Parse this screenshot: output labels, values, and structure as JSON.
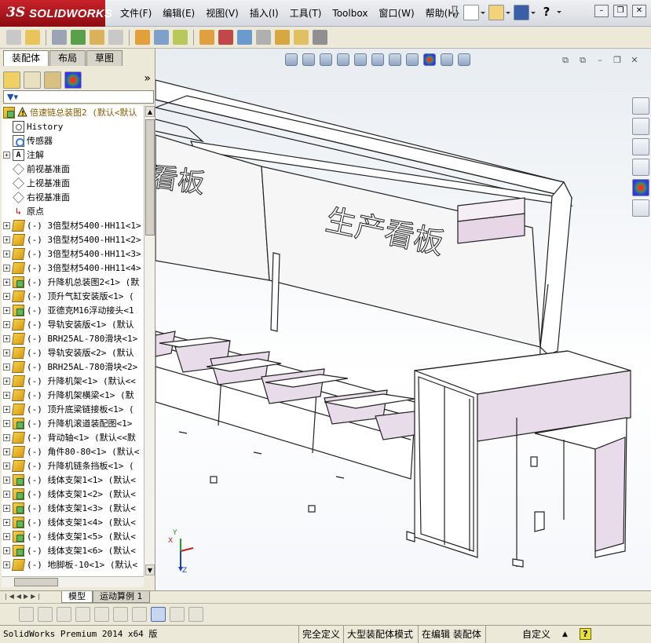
{
  "app": {
    "logo_prefix": "3S",
    "logo_name": "SOLIDWORKS"
  },
  "menu": [
    "文件(F)",
    "编辑(E)",
    "视图(V)",
    "插入(I)",
    "工具(T)",
    "Toolbox",
    "窗口(W)",
    "帮助(H)"
  ],
  "window_buttons": [
    "?",
    "–",
    "❐",
    "✕"
  ],
  "panel_tabs": [
    "装配体",
    "布局",
    "草图"
  ],
  "feature_tree": {
    "root": "倍速链总装图2  (默认<默认",
    "items": [
      {
        "label": "History",
        "icon": "history-icon",
        "expand": false
      },
      {
        "label": "传感器",
        "icon": "sensor-icon",
        "expand": false
      },
      {
        "label": "注解",
        "icon": "annotation-icon",
        "expand": true
      },
      {
        "label": "前视基准面",
        "icon": "plane-icon",
        "expand": false
      },
      {
        "label": "上视基准面",
        "icon": "plane-icon",
        "expand": false
      },
      {
        "label": "右视基准面",
        "icon": "plane-icon",
        "expand": false
      },
      {
        "label": "原点",
        "icon": "origin-icon",
        "expand": false
      },
      {
        "label": "(-) 3倍型材5400-HH11<1>",
        "icon": "part-icon",
        "expand": true
      },
      {
        "label": "(-) 3倍型材5400-HH11<2>",
        "icon": "part-icon",
        "expand": true
      },
      {
        "label": "(-) 3倍型材5400-HH11<3>",
        "icon": "part-icon",
        "expand": true
      },
      {
        "label": "(-) 3倍型材5400-HH11<4>",
        "icon": "part-icon",
        "expand": true
      },
      {
        "label": "(-) 升降机总装图2<1> (默",
        "icon": "assembly-icon",
        "expand": true
      },
      {
        "label": "(-) 顶升气缸安装版<1> (",
        "icon": "part-icon",
        "expand": true
      },
      {
        "label": "(-) 亚德克M16浮动接头<1",
        "icon": "assembly-icon",
        "expand": true
      },
      {
        "label": "(-) 导轨安装版<1> (默认",
        "icon": "part-icon",
        "expand": true
      },
      {
        "label": "(-) BRH25AL-780滑块<1>",
        "icon": "part-icon",
        "expand": true
      },
      {
        "label": "(-) 导轨安装版<2> (默认",
        "icon": "part-icon",
        "expand": true
      },
      {
        "label": "(-) BRH25AL-780滑块<2>",
        "icon": "part-icon",
        "expand": true
      },
      {
        "label": "(-) 升降机架<1> (默认<<",
        "icon": "part-icon",
        "expand": true
      },
      {
        "label": "(-) 升降机架横梁<1> (默",
        "icon": "part-icon",
        "expand": true
      },
      {
        "label": "(-) 顶升底梁链接板<1> (",
        "icon": "part-icon",
        "expand": true
      },
      {
        "label": "(-) 升降机滚道装配图<1>",
        "icon": "assembly-icon",
        "expand": true
      },
      {
        "label": "(-) 背动轴<1> (默认<<默",
        "icon": "part-icon",
        "expand": true
      },
      {
        "label": "(-) 角件80-80<1> (默认<",
        "icon": "part-icon",
        "expand": true
      },
      {
        "label": "(-) 升降机链条挡板<1> (",
        "icon": "part-icon",
        "expand": true
      },
      {
        "label": "(-) 线体支架1<1> (默认<",
        "icon": "assembly-icon",
        "expand": true
      },
      {
        "label": "(-) 线体支架1<2> (默认<",
        "icon": "assembly-icon",
        "expand": true
      },
      {
        "label": "(-) 线体支架1<3> (默认<",
        "icon": "assembly-icon",
        "expand": true
      },
      {
        "label": "(-) 线体支架1<4> (默认<",
        "icon": "assembly-icon",
        "expand": true
      },
      {
        "label": "(-) 线体支架1<5> (默认<",
        "icon": "assembly-icon",
        "expand": true
      },
      {
        "label": "(-) 线体支架1<6> (默认<",
        "icon": "assembly-icon",
        "expand": true
      },
      {
        "label": "(-) 地脚板-10<1> (默认<",
        "icon": "part-icon",
        "expand": true
      }
    ]
  },
  "model": {
    "signboard_text": "生产看板",
    "signboard_text_partial": "看板"
  },
  "triad": {
    "x": "X",
    "y": "Y",
    "z": "Z"
  },
  "bottom_tabs": [
    "模型",
    "运动算例 1"
  ],
  "status": {
    "product": "SolidWorks Premium 2014 x64 版",
    "state": "完全定义",
    "mode": "大型装配体模式",
    "editing": "在编辑 装配体",
    "units": "自定义",
    "units_arrow": "▲",
    "help": "?"
  },
  "colors": {
    "brand_red": "#b01a20",
    "bin_fill": "#e9dcea",
    "frame_line": "#222222"
  }
}
